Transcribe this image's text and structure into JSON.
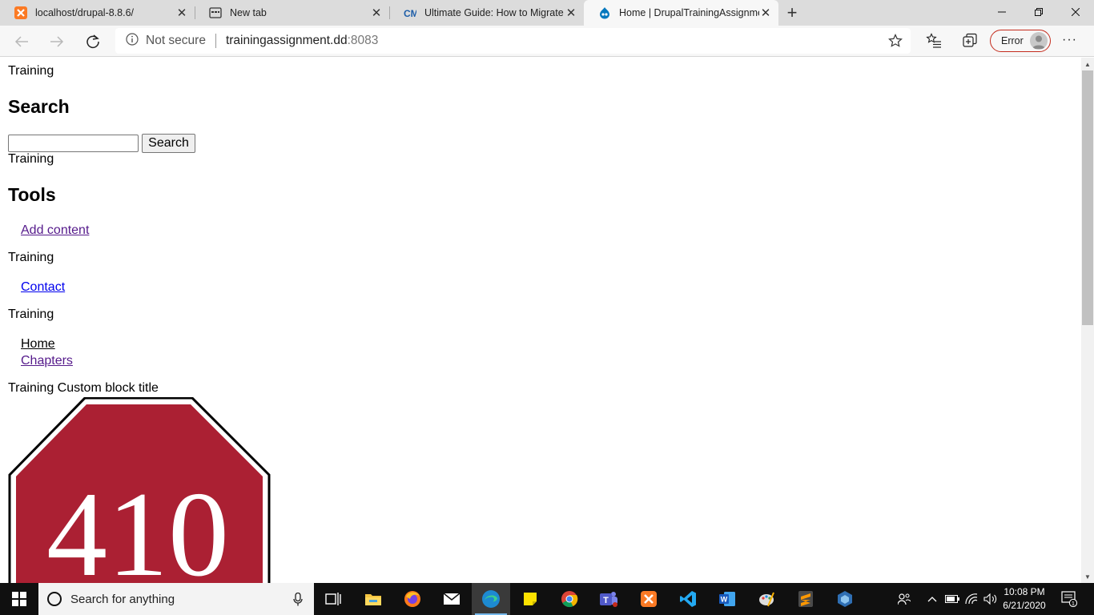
{
  "browser": {
    "tabs": [
      {
        "title": "localhost/drupal-8.8.6/",
        "icon": "xampp-icon"
      },
      {
        "title": "New tab",
        "icon": "newtab-icon"
      },
      {
        "title": "Ultimate Guide: How to Migrate",
        "icon": "cm-icon"
      },
      {
        "title": "Home | DrupalTrainingAssignme",
        "icon": "drupal-icon",
        "active": true
      }
    ],
    "omnibox": {
      "security_label": "Not secure",
      "url_host": "trainingassignment.dd",
      "url_port": ":8083"
    },
    "profile_label": "Error"
  },
  "page": {
    "label_1": "Training",
    "search_heading": "Search",
    "search_button": "Search",
    "label_2": "Training",
    "tools_heading": "Tools",
    "add_content_link": "Add content",
    "label_3": "Training",
    "contact_link": "Contact",
    "label_4": "Training",
    "home_link": "Home",
    "chapters_link": "Chapters",
    "custom_block_title": "Training Custom block title",
    "sign_number": "410",
    "sign_color": "#ab2033"
  },
  "taskbar": {
    "search_placeholder": "Search for anything",
    "time": "10:08 PM",
    "date": "6/21/2020",
    "notification_count": "1"
  }
}
